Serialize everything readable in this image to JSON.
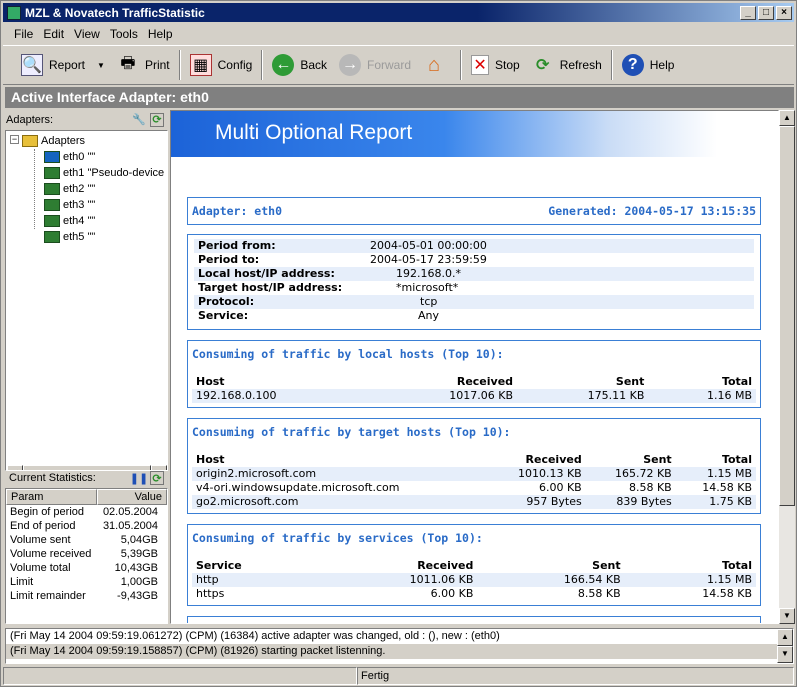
{
  "window": {
    "title": "MZL & Novatech TrafficStatistic"
  },
  "menu": [
    "File",
    "Edit",
    "View",
    "Tools",
    "Help"
  ],
  "toolbar": {
    "report": "Report",
    "print": "Print",
    "config": "Config",
    "back": "Back",
    "forward": "Forward",
    "stop": "Stop",
    "refresh": "Refresh",
    "help": "Help"
  },
  "header": {
    "title": "Active Interface Adapter: eth0"
  },
  "sidebar": {
    "adapters_label": "Adapters:",
    "root": "Adapters",
    "items": [
      "eth0 \"\"",
      "eth1 \"Pseudo-device",
      "eth2 \"\"",
      "eth3 \"\"",
      "eth4 \"\"",
      "eth5 \"\""
    ],
    "stats_label": "Current Statistics:",
    "stats_headers": {
      "param": "Param",
      "value": "Value"
    },
    "stats": [
      {
        "param": "Begin of period",
        "value": "02.05.2004"
      },
      {
        "param": "End of period",
        "value": "31.05.2004"
      },
      {
        "param": "Volume sent",
        "value": "5,04GB"
      },
      {
        "param": "Volume received",
        "value": "5,39GB"
      },
      {
        "param": "Volume total",
        "value": "10,43GB"
      },
      {
        "param": "Limit",
        "value": "1,00GB"
      },
      {
        "param": "Limit remainder",
        "value": "-9,43GB"
      }
    ]
  },
  "report": {
    "banner": "Multi Optional Report",
    "adapter": "Adapter: eth0",
    "generated": "Generated: 2004-05-17 13:15:35",
    "info": [
      {
        "k": "Period from:",
        "v": "2004-05-01 00:00:00"
      },
      {
        "k": "Period to:",
        "v": "2004-05-17 23:59:59"
      },
      {
        "k": "Local host/IP address:",
        "v": "192.168.0.*"
      },
      {
        "k": "Target host/IP address:",
        "v": "*microsoft*"
      },
      {
        "k": "Protocol:",
        "v": "tcp"
      },
      {
        "k": "Service:",
        "v": "Any"
      }
    ],
    "local": {
      "title": "Consuming of traffic by local hosts (Top 10):",
      "headers": [
        "Host",
        "Received",
        "Sent",
        "Total"
      ],
      "rows": [
        [
          "192.168.0.100",
          "1017.06 KB",
          "175.11 KB",
          "1.16 MB"
        ]
      ]
    },
    "target": {
      "title": "Consuming of traffic by target hosts (Top 10):",
      "headers": [
        "Host",
        "Received",
        "Sent",
        "Total"
      ],
      "rows": [
        [
          "origin2.microsoft.com",
          "1010.13 KB",
          "165.72 KB",
          "1.15 MB"
        ],
        [
          "v4-ori.windowsupdate.microsoft.com",
          "6.00 KB",
          "8.58 KB",
          "14.58 KB"
        ],
        [
          "go2.microsoft.com",
          "957 Bytes",
          "839 Bytes",
          "1.75 KB"
        ]
      ]
    },
    "services": {
      "title": "Consuming of traffic by services (Top 10):",
      "headers": [
        "Service",
        "Received",
        "Sent",
        "Total"
      ],
      "rows": [
        [
          "http",
          "1011.06 KB",
          "166.54 KB",
          "1.15 MB"
        ],
        [
          "https",
          "6.00 KB",
          "8.58 KB",
          "14.58 KB"
        ]
      ]
    }
  },
  "log": [
    "(Fri May 14 2004 09:59:19.061272) (CPM) (16384) active adapter was changed, old : (), new : (eth0)",
    "(Fri May 14 2004 09:59:19.158857) (CPM) (81926) starting packet listenning."
  ],
  "status": {
    "text": "Fertig"
  }
}
